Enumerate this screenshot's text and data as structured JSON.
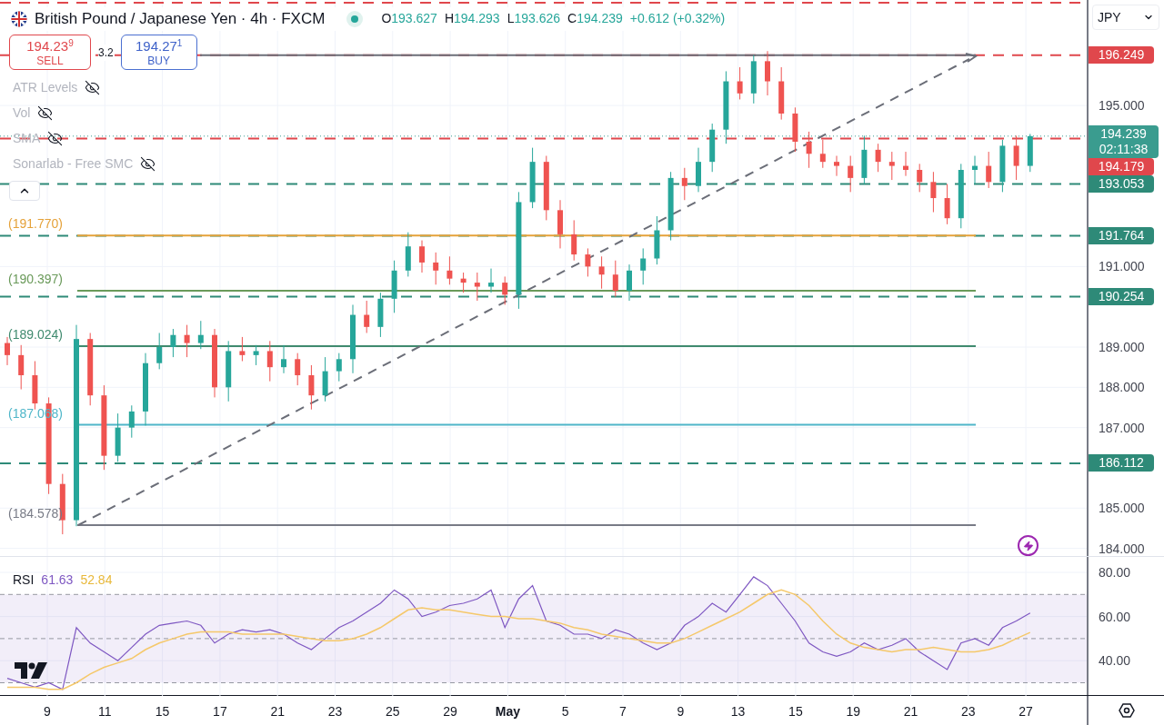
{
  "header": {
    "symbol": "British Pound / Japanese Yen · 4h · FXCM",
    "market_open": true,
    "ohlc": [
      {
        "label": "O",
        "value": "193.627"
      },
      {
        "label": "H",
        "value": "194.293"
      },
      {
        "label": "L",
        "value": "193.626"
      },
      {
        "label": "C",
        "value": "194.239"
      }
    ],
    "change": "+0.612 (+0.32%)"
  },
  "trade": {
    "sell": {
      "price": "194.23",
      "pip": "9",
      "label": "SELL"
    },
    "spread": "3.2",
    "buy": {
      "price": "194.27",
      "pip": "1",
      "label": "BUY"
    }
  },
  "indicators": [
    {
      "name": "ATR Levels",
      "hidden": true
    },
    {
      "name": "Vol",
      "hidden": true
    },
    {
      "name": "SMA",
      "hidden": true
    },
    {
      "name": "Sonarlab - Free SMC",
      "hidden": true
    }
  ],
  "currency": "JPY",
  "levels": [
    {
      "label": "(191.770)",
      "color": "#e5a23a"
    },
    {
      "label": "(190.397)",
      "color": "#6a9a5a"
    },
    {
      "label": "(189.024)",
      "color": "#3f8a6e"
    },
    {
      "label": "(187.068)",
      "color": "#4fb6c9"
    },
    {
      "label": "(184.578)",
      "color": "#787b86"
    }
  ],
  "price_tags": [
    {
      "value": "196.249",
      "kind": "line",
      "color": "#e0474c"
    },
    {
      "value": "194.239",
      "sub": "02:11:38",
      "kind": "current",
      "color": "#3a9c8f"
    },
    {
      "value": "194.179",
      "kind": "line",
      "color": "#e0474c"
    },
    {
      "value": "193.053",
      "kind": "line",
      "color": "#2e8a78"
    },
    {
      "value": "191.764",
      "kind": "line",
      "color": "#2e8a78"
    },
    {
      "value": "190.254",
      "kind": "line",
      "color": "#2e8a78"
    },
    {
      "value": "186.112",
      "kind": "line",
      "color": "#2e8a78"
    }
  ],
  "price_chart": {
    "chart_data": {
      "type": "candlestick",
      "grid": true,
      "ylim": [
        183.81,
        197.62
      ],
      "ref_lines": [
        {
          "axis": "y",
          "value": 196.249,
          "color": "#e0474c"
        },
        {
          "axis": "y",
          "value": 194.239,
          "color": "#3a9c8f"
        },
        {
          "axis": "y",
          "value": 194.179,
          "color": "#e0474c"
        },
        {
          "axis": "y",
          "value": 193.053,
          "color": "#2e8a78"
        },
        {
          "axis": "y",
          "value": 191.764,
          "color": "#2e8a78"
        },
        {
          "axis": "y",
          "value": 190.254,
          "color": "#2e8a78"
        },
        {
          "axis": "y",
          "value": 186.112,
          "color": "#2e8a78"
        },
        {
          "axis": "y",
          "value": 191.77,
          "color": "#e5a23a"
        },
        {
          "axis": "y",
          "value": 190.397,
          "color": "#6a9a5a"
        },
        {
          "axis": "y",
          "value": 189.024,
          "color": "#3f8a6e"
        },
        {
          "axis": "y",
          "value": 187.068,
          "color": "#4fb6c9"
        },
        {
          "axis": "y",
          "value": 184.578,
          "color": "#787b86"
        },
        {
          "axis": "y",
          "value": 197.55,
          "color": "#e0474c"
        },
        {
          "axis": "y",
          "value": 196.249,
          "color": "#6b6e78"
        }
      ],
      "categories": [
        null,
        null,
        null,
        null,
        null,
        null,
        null,
        null,
        null,
        null,
        null,
        null,
        null,
        null,
        null,
        null,
        null,
        null,
        null,
        null,
        null,
        null,
        null,
        null,
        null,
        null,
        null,
        null,
        null,
        null,
        null,
        null,
        null,
        null,
        null,
        null,
        null,
        null,
        null,
        null,
        null,
        null,
        null,
        null,
        null,
        null,
        null,
        null,
        null,
        null,
        null,
        null,
        null,
        null,
        null,
        null,
        null,
        null,
        null,
        null,
        null,
        null,
        null,
        null,
        null,
        null,
        null,
        null,
        null,
        null,
        null,
        null,
        null,
        null,
        null
      ],
      "ohlc": [
        [
          189.1,
          189.25,
          188.55,
          188.8
        ],
        [
          188.8,
          189.05,
          187.95,
          188.3
        ],
        [
          188.3,
          188.65,
          187.45,
          187.6
        ],
        [
          187.6,
          187.75,
          185.35,
          185.6
        ],
        [
          185.6,
          185.85,
          184.35,
          184.7
        ],
        [
          184.7,
          189.55,
          184.55,
          189.2
        ],
        [
          189.2,
          189.35,
          187.55,
          187.8
        ],
        [
          187.8,
          188.05,
          185.95,
          186.3
        ],
        [
          186.3,
          187.35,
          186.15,
          187.0
        ],
        [
          187.0,
          187.55,
          186.75,
          187.4
        ],
        [
          187.4,
          188.85,
          187.05,
          188.6
        ],
        [
          188.6,
          189.35,
          188.45,
          189.0
        ],
        [
          189.0,
          189.45,
          188.75,
          189.3
        ],
        [
          189.3,
          189.55,
          188.75,
          189.1
        ],
        [
          189.1,
          189.65,
          188.95,
          189.3
        ],
        [
          189.3,
          189.45,
          187.75,
          188.0
        ],
        [
          188.0,
          189.15,
          187.65,
          188.9
        ],
        [
          188.9,
          189.25,
          188.65,
          188.8
        ],
        [
          188.8,
          189.05,
          188.55,
          188.9
        ],
        [
          188.9,
          189.15,
          188.15,
          188.5
        ],
        [
          188.5,
          189.05,
          188.35,
          188.7
        ],
        [
          188.7,
          188.85,
          188.05,
          188.3
        ],
        [
          188.3,
          188.55,
          187.45,
          187.8
        ],
        [
          187.8,
          188.75,
          187.65,
          188.4
        ],
        [
          188.4,
          188.85,
          188.15,
          188.7
        ],
        [
          188.7,
          190.05,
          188.35,
          189.8
        ],
        [
          189.8,
          190.15,
          189.35,
          189.5
        ],
        [
          189.5,
          190.35,
          189.25,
          190.2
        ],
        [
          190.2,
          191.15,
          189.85,
          190.9
        ],
        [
          190.9,
          191.85,
          190.75,
          191.5
        ],
        [
          191.5,
          191.65,
          190.85,
          191.1
        ],
        [
          191.1,
          191.35,
          190.55,
          190.9
        ],
        [
          190.9,
          191.25,
          190.55,
          190.7
        ],
        [
          190.7,
          190.85,
          190.35,
          190.6
        ],
        [
          190.6,
          190.85,
          190.15,
          190.5
        ],
        [
          190.5,
          190.95,
          190.35,
          190.6
        ],
        [
          190.6,
          190.75,
          190.05,
          190.3
        ],
        [
          190.3,
          192.85,
          189.95,
          192.6
        ],
        [
          192.6,
          193.95,
          192.45,
          193.6
        ],
        [
          193.6,
          193.75,
          192.15,
          192.4
        ],
        [
          192.4,
          192.65,
          191.45,
          191.8
        ],
        [
          191.8,
          192.15,
          191.15,
          191.3
        ],
        [
          191.3,
          191.45,
          190.75,
          191.0
        ],
        [
          191.0,
          191.25,
          190.45,
          190.8
        ],
        [
          190.8,
          191.15,
          190.25,
          190.4
        ],
        [
          190.4,
          191.05,
          190.15,
          190.9
        ],
        [
          190.9,
          191.45,
          190.55,
          191.2
        ],
        [
          191.2,
          192.25,
          191.05,
          191.9
        ],
        [
          191.9,
          193.35,
          191.65,
          193.2
        ],
        [
          193.2,
          193.45,
          192.65,
          193.0
        ],
        [
          193.0,
          193.95,
          192.85,
          193.6
        ],
        [
          193.6,
          194.55,
          193.35,
          194.4
        ],
        [
          194.4,
          195.85,
          194.05,
          195.6
        ],
        [
          195.6,
          195.95,
          195.15,
          195.3
        ],
        [
          195.3,
          196.25,
          195.05,
          196.1
        ],
        [
          196.1,
          196.35,
          195.25,
          195.6
        ],
        [
          195.6,
          195.95,
          194.65,
          194.8
        ],
        [
          194.8,
          194.95,
          193.85,
          194.1
        ],
        [
          194.1,
          194.35,
          193.45,
          193.8
        ],
        [
          193.8,
          194.15,
          193.45,
          193.6
        ],
        [
          193.6,
          193.75,
          193.25,
          193.5
        ],
        [
          193.5,
          193.75,
          192.85,
          193.2
        ],
        [
          193.2,
          194.25,
          193.05,
          193.9
        ],
        [
          193.9,
          194.05,
          193.35,
          193.6
        ],
        [
          193.6,
          193.85,
          193.15,
          193.5
        ],
        [
          193.5,
          193.85,
          193.25,
          193.4
        ],
        [
          193.4,
          193.55,
          192.85,
          193.1
        ],
        [
          193.1,
          193.35,
          192.35,
          192.7
        ],
        [
          192.7,
          193.05,
          192.05,
          192.2
        ],
        [
          192.2,
          193.55,
          191.95,
          193.4
        ],
        [
          193.4,
          193.75,
          193.05,
          193.5
        ],
        [
          193.5,
          193.85,
          192.95,
          193.1
        ],
        [
          193.1,
          194.15,
          192.85,
          194.0
        ],
        [
          194.0,
          194.25,
          193.15,
          193.5
        ],
        [
          193.5,
          194.293,
          193.35,
          194.239
        ]
      ],
      "yticks": [
        {
          "value": 184,
          "label": "184.000"
        },
        {
          "value": 185,
          "label": "185.000"
        },
        {
          "value": 187,
          "label": "187.000"
        },
        {
          "value": 188,
          "label": "188.000"
        },
        {
          "value": 189,
          "label": "189.000"
        },
        {
          "value": 191,
          "label": "191.000"
        },
        {
          "value": 195,
          "label": "195.000"
        }
      ]
    }
  },
  "time_axis": [
    {
      "label": "9",
      "kind": "day"
    },
    {
      "label": "11",
      "kind": "day"
    },
    {
      "label": "15",
      "kind": "day"
    },
    {
      "label": "17",
      "kind": "day"
    },
    {
      "label": "21",
      "kind": "day"
    },
    {
      "label": "23",
      "kind": "day"
    },
    {
      "label": "25",
      "kind": "day"
    },
    {
      "label": "29",
      "kind": "day"
    },
    {
      "label": "May",
      "kind": "month"
    },
    {
      "label": "5",
      "kind": "day"
    },
    {
      "label": "7",
      "kind": "day"
    },
    {
      "label": "9",
      "kind": "day"
    },
    {
      "label": "13",
      "kind": "day"
    },
    {
      "label": "15",
      "kind": "day"
    },
    {
      "label": "19",
      "kind": "day"
    },
    {
      "label": "21",
      "kind": "day"
    },
    {
      "label": "23",
      "kind": "day"
    },
    {
      "label": "27",
      "kind": "day"
    }
  ],
  "rsi": {
    "value": "61.63",
    "ma_value": "52.84",
    "chart_data": {
      "type": "line",
      "grid": true,
      "ylim": [
        24.03,
        87
      ],
      "bands": [
        {
          "axis": "y",
          "from": 30,
          "to": 70,
          "color": "#7e57c2"
        }
      ],
      "ref_lines": [
        {
          "axis": "y",
          "value": 70
        },
        {
          "axis": "y",
          "value": 50
        },
        {
          "axis": "y",
          "value": 30
        }
      ],
      "series": [
        {
          "name": "RSI",
          "color": "#7e57c2",
          "values": [
            32,
            30,
            28,
            30,
            27,
            55,
            48,
            44,
            40,
            46,
            52,
            56,
            57,
            58,
            56,
            48,
            52,
            54,
            53,
            54,
            52,
            48,
            45,
            50,
            55,
            58,
            62,
            66,
            72,
            68,
            60,
            62,
            65,
            66,
            68,
            72,
            55,
            68,
            74,
            58,
            56,
            52,
            52,
            50,
            54,
            52,
            48,
            45,
            48,
            56,
            60,
            66,
            62,
            70,
            78,
            74,
            66,
            58,
            48,
            44,
            42,
            44,
            48,
            45,
            47,
            50,
            44,
            40,
            36,
            48,
            50,
            47,
            55,
            58,
            61.6
          ]
        },
        {
          "color": "#f5c86a",
          "values": [
            28,
            28,
            28,
            27,
            27,
            30,
            34,
            37,
            39,
            41,
            45,
            48,
            50,
            52,
            53,
            53,
            53,
            52,
            52,
            52,
            52,
            51,
            50,
            49,
            49,
            50,
            52,
            55,
            59,
            63,
            64,
            63,
            63,
            62,
            61,
            60,
            60,
            59,
            59,
            58,
            57,
            55,
            54,
            52,
            51,
            50,
            49,
            48,
            48,
            50,
            53,
            56,
            59,
            62,
            66,
            70,
            72,
            70,
            65,
            58,
            52,
            48,
            46,
            45,
            44,
            45,
            45,
            46,
            45,
            44,
            44,
            45,
            47,
            50,
            52.8
          ]
        }
      ],
      "yticks": [
        {
          "value": 40,
          "label": "40.00"
        },
        {
          "value": 60,
          "label": "60.00"
        },
        {
          "value": 80,
          "label": "80.00"
        }
      ]
    }
  }
}
